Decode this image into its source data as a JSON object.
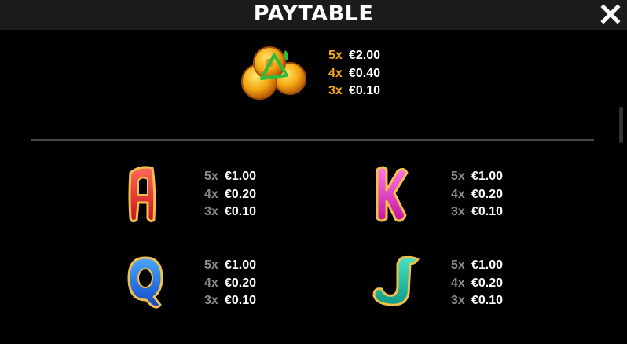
{
  "header": {
    "title": "PAYTABLE",
    "close_icon": "close-icon"
  },
  "colors": {
    "background": "#000000",
    "header": "#1b1b1b",
    "multiplier_gold": "#f2a819",
    "multiplier_gray": "#8a8a8a",
    "amount": "#ffffff"
  },
  "top_symbol": {
    "icon": "gold-coins-icon",
    "pays": [
      {
        "mult": "5x",
        "amount": "€2.00"
      },
      {
        "mult": "4x",
        "amount": "€0.40"
      },
      {
        "mult": "3x",
        "amount": "€0.10"
      }
    ]
  },
  "symbols": [
    {
      "icon": "letter-a-icon",
      "pays": [
        {
          "mult": "5x",
          "amount": "€1.00"
        },
        {
          "mult": "4x",
          "amount": "€0.20"
        },
        {
          "mult": "3x",
          "amount": "€0.10"
        }
      ]
    },
    {
      "icon": "letter-k-icon",
      "pays": [
        {
          "mult": "5x",
          "amount": "€1.00"
        },
        {
          "mult": "4x",
          "amount": "€0.20"
        },
        {
          "mult": "3x",
          "amount": "€0.10"
        }
      ]
    },
    {
      "icon": "letter-q-icon",
      "pays": [
        {
          "mult": "5x",
          "amount": "€1.00"
        },
        {
          "mult": "4x",
          "amount": "€0.20"
        },
        {
          "mult": "3x",
          "amount": "€0.10"
        }
      ]
    },
    {
      "icon": "letter-j-icon",
      "pays": [
        {
          "mult": "5x",
          "amount": "€1.00"
        },
        {
          "mult": "4x",
          "amount": "€0.20"
        },
        {
          "mult": "3x",
          "amount": "€0.10"
        }
      ]
    }
  ]
}
